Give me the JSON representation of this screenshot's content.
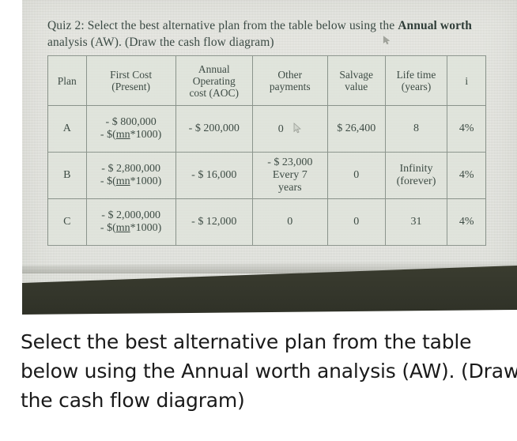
{
  "photo": {
    "heading": {
      "prefix": "Quiz 2: Select the best alternative plan from the table below using the ",
      "bold1": "Annual worth",
      "suffix": " analysis (AW). (Draw the cash flow diagram)"
    },
    "cursor_icon": "mouse-pointer-icon"
  },
  "table": {
    "headers": [
      "Plan",
      "First Cost (Present)",
      "Annual Operating cost (AOC)",
      "Other payments",
      "Salvage value",
      "Life time (years)",
      "i"
    ],
    "headers_split": {
      "plan": "Plan",
      "first_cost_l1": "First Cost",
      "first_cost_l2": "(Present)",
      "aoc_l1": "Annual",
      "aoc_l2": "Operating",
      "aoc_l3": "cost (AOC)",
      "other_l1": "Other",
      "other_l2": "payments",
      "salvage_l1": "Salvage",
      "salvage_l2": "value",
      "life_l1": "Life time",
      "life_l2": "(years)",
      "i": "i"
    },
    "rows": [
      {
        "plan": "A",
        "first_cost_l1": "- $ 800,000",
        "first_cost_l2_pre": "- $(",
        "first_cost_l2_u": "mn",
        "first_cost_l2_post": "*1000)",
        "aoc": "- $ 200,000",
        "other": "0",
        "other_l2": "",
        "other_l3": "",
        "salvage": "$ 26,400",
        "life_l1": "8",
        "life_l2": "",
        "i": "4%",
        "has_pointer": true
      },
      {
        "plan": "B",
        "first_cost_l1": "- $ 2,800,000",
        "first_cost_l2_pre": "- $(",
        "first_cost_l2_u": "mn",
        "first_cost_l2_post": "*1000)",
        "aoc": "- $ 16,000",
        "other": "- $ 23,000",
        "other_l2": "Every 7",
        "other_l3": "years",
        "salvage": "0",
        "life_l1": "Infinity",
        "life_l2": "(forever)",
        "i": "4%",
        "has_pointer": false
      },
      {
        "plan": "C",
        "first_cost_l1": "- $ 2,000,000",
        "first_cost_l2_pre": "- $(",
        "first_cost_l2_u": "mn",
        "first_cost_l2_post": "*1000)",
        "aoc": "- $ 12,000",
        "other": "0",
        "other_l2": "",
        "other_l3": "",
        "salvage": "0",
        "life_l1": "31",
        "life_l2": "",
        "i": "4%",
        "has_pointer": false
      }
    ]
  },
  "caption": {
    "text": "Select the best alternative plan from the table below using the Annual worth analysis (AW). (Draw the cash flow diagram)"
  },
  "colors": {
    "paper": "#dcddd6",
    "table_cell": "#dfe5dc",
    "table_border": "#8b948c",
    "ink": "#3e4c45",
    "desk_band": "#34362b",
    "caption_text": "#1a1a1a"
  }
}
